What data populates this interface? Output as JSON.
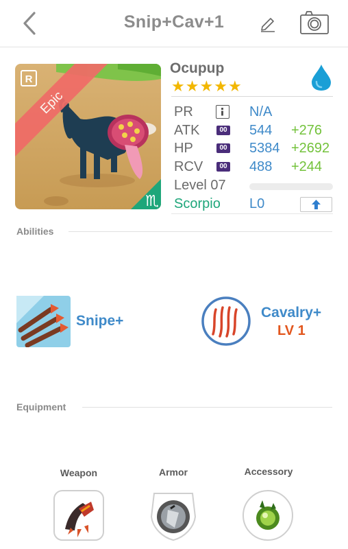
{
  "header": {
    "title": "Snip+Cav+1"
  },
  "monster": {
    "name": "Ocupup",
    "rarity": "Epic",
    "rarity_badge": "R",
    "stars": 5,
    "element_icon": "water-drop-icon",
    "element_color": "#1a9fd6"
  },
  "stats": {
    "pr": {
      "label": "PR",
      "value": "N/A"
    },
    "atk": {
      "label": "ATK",
      "tag": "00",
      "value": "544",
      "bonus": "+276"
    },
    "hp": {
      "label": "HP",
      "tag": "00",
      "value": "5384",
      "bonus": "+2692"
    },
    "rcv": {
      "label": "RCV",
      "tag": "00",
      "value": "488",
      "bonus": "+244"
    },
    "level": {
      "label": "Level 07",
      "progress": 0
    },
    "zodiac": {
      "name": "Scorpio",
      "symbol": "♏",
      "luck": "L0"
    }
  },
  "sections": {
    "abilities": "Abilities",
    "equipment": "Equipment"
  },
  "abilities": [
    {
      "name": "Snipe+",
      "icon": "triple-arrow-icon"
    },
    {
      "name": "Cavalry+",
      "level": "LV 1",
      "icon": "claw-marks-icon"
    }
  ],
  "equipment": [
    {
      "label": "Weapon",
      "icon": "claw-weapon-icon"
    },
    {
      "label": "Armor",
      "icon": "shield-armor-icon"
    },
    {
      "label": "Accessory",
      "icon": "green-orb-accessory-icon"
    }
  ],
  "colors": {
    "accent": "#3f8ac9",
    "bonus": "#73c23b",
    "zodiac": "#1ea67a",
    "star": "#f2b700",
    "rarity_epic": "#f06b67",
    "skill_level": "#e2561d"
  }
}
